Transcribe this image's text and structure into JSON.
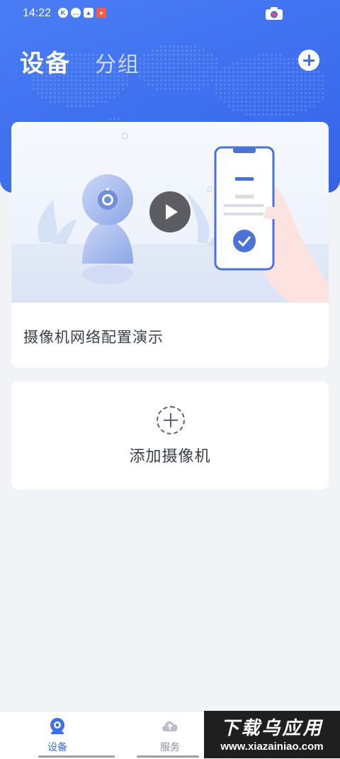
{
  "status_bar": {
    "time": "14:22",
    "icons": [
      "K",
      "…",
      "▲",
      "●"
    ]
  },
  "header": {
    "tab_devices": "设备",
    "tab_groups": "分组"
  },
  "demo_card": {
    "title": "摄像机网络配置演示"
  },
  "add_card": {
    "label": "添加摄像机"
  },
  "tabbar": {
    "devices_label": "设备",
    "services_label": "服务"
  },
  "watermark": {
    "title": "下载乌应用",
    "url": "www.xiazainiao.com"
  },
  "colors": {
    "accent": "#3c6eee",
    "background": "#f2f3f7",
    "card": "#ffffff",
    "text_primary": "#3a3f4a"
  }
}
